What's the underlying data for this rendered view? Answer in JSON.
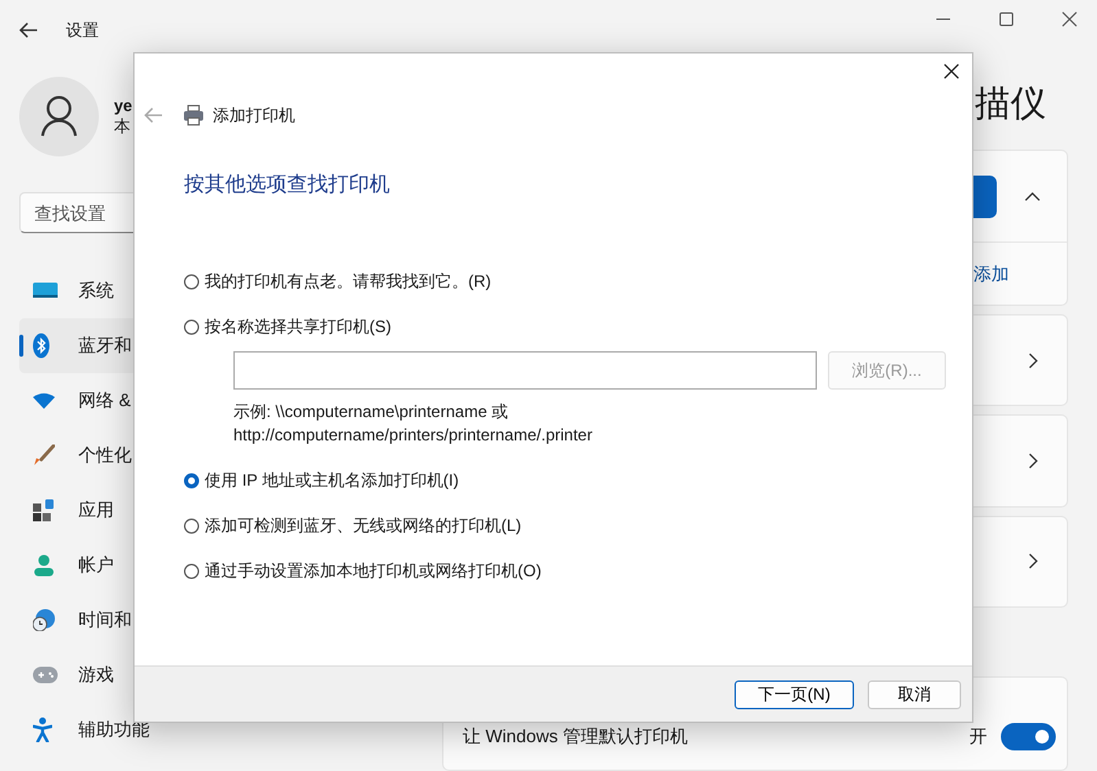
{
  "window": {
    "title": "设置"
  },
  "user": {
    "name": "ye",
    "subtitle": "本"
  },
  "search": {
    "placeholder": "查找设置"
  },
  "nav": [
    {
      "label": "系统",
      "selected": false
    },
    {
      "label": "蓝牙和",
      "selected": true
    },
    {
      "label": "网络 &",
      "selected": false
    },
    {
      "label": "个性化",
      "selected": false
    },
    {
      "label": "应用",
      "selected": false
    },
    {
      "label": "帐户",
      "selected": false
    },
    {
      "label": "时间和",
      "selected": false
    },
    {
      "label": "游戏",
      "selected": false
    },
    {
      "label": "辅助功能",
      "selected": false
    }
  ],
  "page": {
    "title": "描仪",
    "add_card": {
      "expanded": true,
      "link": "添加"
    },
    "cards": [
      {
        "kind": "chevron"
      },
      {
        "kind": "chevron"
      },
      {
        "kind": "chevron"
      }
    ],
    "default_printer": {
      "label": "让 Windows 管理默认打印机",
      "state": "开",
      "on": true
    }
  },
  "dialog": {
    "title": "添加打印机",
    "heading": "按其他选项查找打印机",
    "options": [
      {
        "label": "我的打印机有点老。请帮我找到它。(R)",
        "selected": false
      },
      {
        "label": "按名称选择共享打印机(S)",
        "selected": false,
        "path": {
          "browse": "浏览(R)...",
          "browse_disabled": true,
          "example": [
            "示例: \\\\computername\\printername 或",
            "http://computername/printers/printername/.printer"
          ]
        }
      },
      {
        "label": "使用 IP 地址或主机名添加打印机(I)",
        "selected": true
      },
      {
        "label": "添加可检测到蓝牙、无线或网络的打印机(L)",
        "selected": false
      },
      {
        "label": "通过手动设置添加本地打印机或网络打印机(O)",
        "selected": false
      }
    ],
    "buttons": [
      {
        "label": "下一页(N)",
        "default": true
      },
      {
        "label": "取消",
        "default": false
      }
    ]
  }
}
